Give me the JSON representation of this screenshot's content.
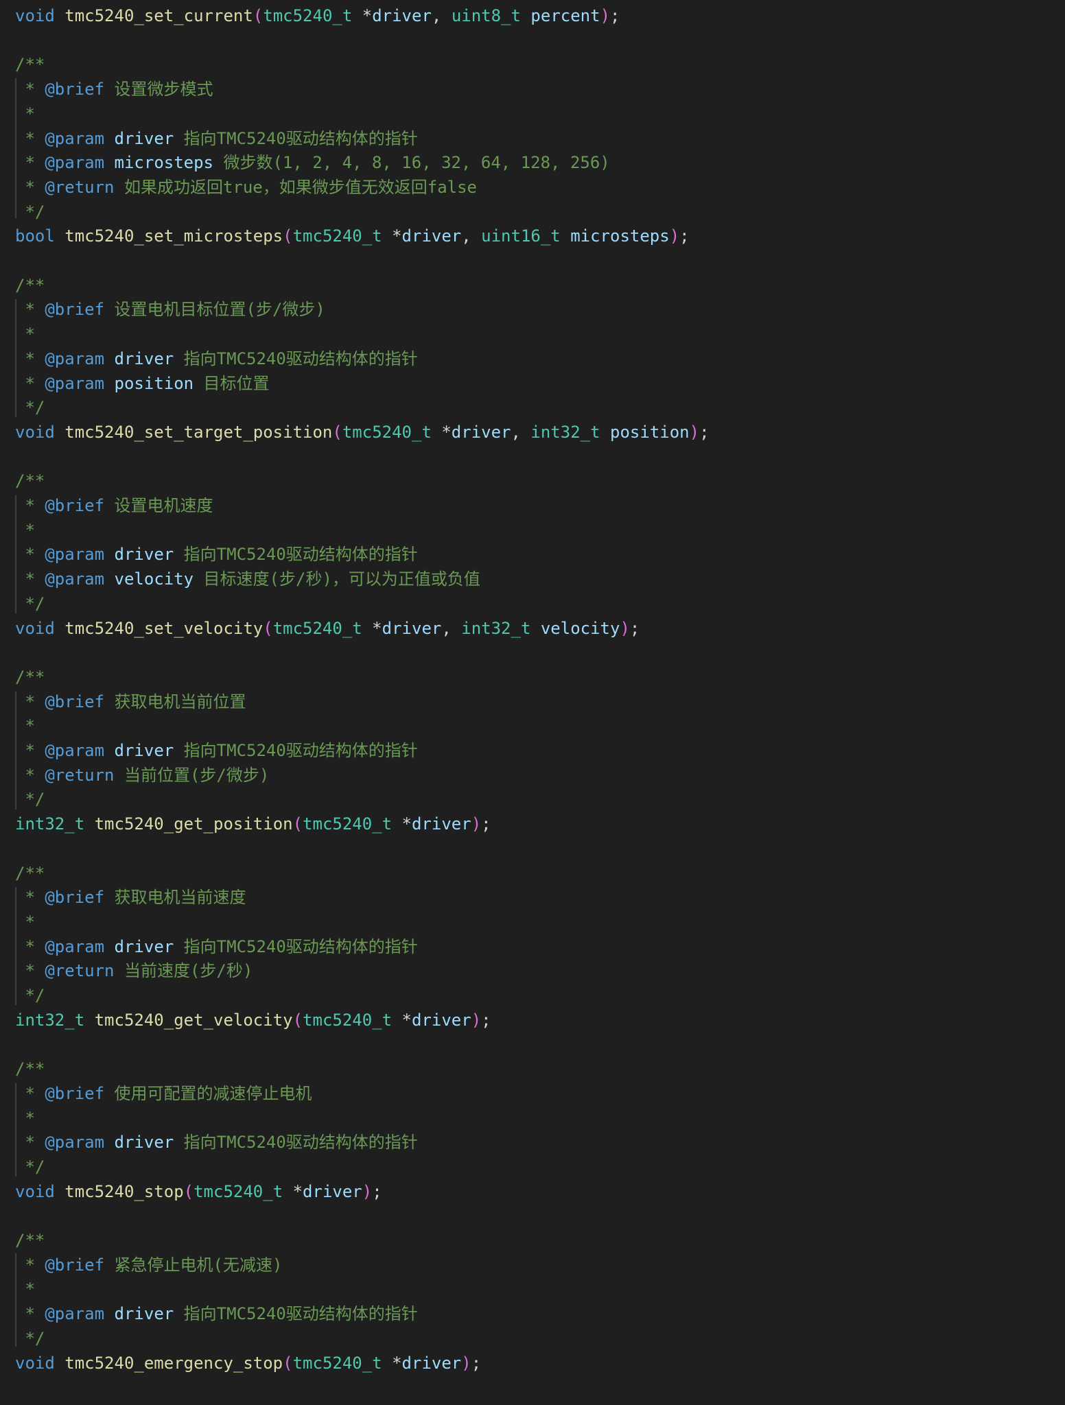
{
  "colors": {
    "background": "#1f1f1f",
    "comment": "#6a9955",
    "doc_tag": "#569cd6",
    "keyword": "#569cd6",
    "type": "#4ec9b0",
    "function": "#dcdcaa",
    "parameter": "#9cdcfe",
    "punctuation": "#d4d4d4",
    "bracket": "#da70d6",
    "indent_guide": "#404040"
  },
  "lines": [
    {
      "tokens": [
        [
          "kw",
          "void"
        ],
        [
          "pn",
          " "
        ],
        [
          "fn",
          "tmc5240_set_current"
        ],
        [
          "br",
          "("
        ],
        [
          "ty",
          "tmc5240_t"
        ],
        [
          "pn",
          " *"
        ],
        [
          "pm",
          "driver"
        ],
        [
          "pn",
          ", "
        ],
        [
          "ty",
          "uint8_t"
        ],
        [
          "pn",
          " "
        ],
        [
          "pm",
          "percent"
        ],
        [
          "br",
          ")"
        ],
        [
          "pn",
          ";"
        ]
      ]
    },
    {
      "tokens": []
    },
    {
      "tokens": [
        [
          "cm",
          "/**"
        ]
      ]
    },
    {
      "tokens": [
        [
          "cm",
          " * "
        ],
        [
          "tag",
          "@brief"
        ],
        [
          "cm",
          " 设置微步模式"
        ]
      ]
    },
    {
      "tokens": [
        [
          "cm",
          " *"
        ]
      ]
    },
    {
      "tokens": [
        [
          "cm",
          " * "
        ],
        [
          "tag",
          "@param"
        ],
        [
          "pn",
          " "
        ],
        [
          "pm",
          "driver"
        ],
        [
          "cm",
          " 指向TMC5240驱动结构体的指针"
        ]
      ]
    },
    {
      "tokens": [
        [
          "cm",
          " * "
        ],
        [
          "tag",
          "@param"
        ],
        [
          "pn",
          " "
        ],
        [
          "pm",
          "microsteps"
        ],
        [
          "cm",
          " 微步数(1, 2, 4, 8, 16, 32, 64, 128, 256)"
        ]
      ]
    },
    {
      "tokens": [
        [
          "cm",
          " * "
        ],
        [
          "tag",
          "@return"
        ],
        [
          "cm",
          " 如果成功返回true，如果微步值无效返回false"
        ]
      ]
    },
    {
      "tokens": [
        [
          "cm",
          " */"
        ]
      ]
    },
    {
      "tokens": [
        [
          "kw",
          "bool"
        ],
        [
          "pn",
          " "
        ],
        [
          "fn",
          "tmc5240_set_microsteps"
        ],
        [
          "br",
          "("
        ],
        [
          "ty",
          "tmc5240_t"
        ],
        [
          "pn",
          " *"
        ],
        [
          "pm",
          "driver"
        ],
        [
          "pn",
          ", "
        ],
        [
          "ty",
          "uint16_t"
        ],
        [
          "pn",
          " "
        ],
        [
          "pm",
          "microsteps"
        ],
        [
          "br",
          ")"
        ],
        [
          "pn",
          ";"
        ]
      ]
    },
    {
      "tokens": []
    },
    {
      "tokens": [
        [
          "cm",
          "/**"
        ]
      ]
    },
    {
      "tokens": [
        [
          "cm",
          " * "
        ],
        [
          "tag",
          "@brief"
        ],
        [
          "cm",
          " 设置电机目标位置(步/微步)"
        ]
      ]
    },
    {
      "tokens": [
        [
          "cm",
          " *"
        ]
      ]
    },
    {
      "tokens": [
        [
          "cm",
          " * "
        ],
        [
          "tag",
          "@param"
        ],
        [
          "pn",
          " "
        ],
        [
          "pm",
          "driver"
        ],
        [
          "cm",
          " 指向TMC5240驱动结构体的指针"
        ]
      ]
    },
    {
      "tokens": [
        [
          "cm",
          " * "
        ],
        [
          "tag",
          "@param"
        ],
        [
          "pn",
          " "
        ],
        [
          "pm",
          "position"
        ],
        [
          "cm",
          " 目标位置"
        ]
      ]
    },
    {
      "tokens": [
        [
          "cm",
          " */"
        ]
      ]
    },
    {
      "tokens": [
        [
          "kw",
          "void"
        ],
        [
          "pn",
          " "
        ],
        [
          "fn",
          "tmc5240_set_target_position"
        ],
        [
          "br",
          "("
        ],
        [
          "ty",
          "tmc5240_t"
        ],
        [
          "pn",
          " *"
        ],
        [
          "pm",
          "driver"
        ],
        [
          "pn",
          ", "
        ],
        [
          "ty",
          "int32_t"
        ],
        [
          "pn",
          " "
        ],
        [
          "pm",
          "position"
        ],
        [
          "br",
          ")"
        ],
        [
          "pn",
          ";"
        ]
      ]
    },
    {
      "tokens": []
    },
    {
      "tokens": [
        [
          "cm",
          "/**"
        ]
      ]
    },
    {
      "tokens": [
        [
          "cm",
          " * "
        ],
        [
          "tag",
          "@brief"
        ],
        [
          "cm",
          " 设置电机速度"
        ]
      ]
    },
    {
      "tokens": [
        [
          "cm",
          " *"
        ]
      ]
    },
    {
      "tokens": [
        [
          "cm",
          " * "
        ],
        [
          "tag",
          "@param"
        ],
        [
          "pn",
          " "
        ],
        [
          "pm",
          "driver"
        ],
        [
          "cm",
          " 指向TMC5240驱动结构体的指针"
        ]
      ]
    },
    {
      "tokens": [
        [
          "cm",
          " * "
        ],
        [
          "tag",
          "@param"
        ],
        [
          "pn",
          " "
        ],
        [
          "pm",
          "velocity"
        ],
        [
          "cm",
          " 目标速度(步/秒)，可以为正值或负值"
        ]
      ]
    },
    {
      "tokens": [
        [
          "cm",
          " */"
        ]
      ]
    },
    {
      "tokens": [
        [
          "kw",
          "void"
        ],
        [
          "pn",
          " "
        ],
        [
          "fn",
          "tmc5240_set_velocity"
        ],
        [
          "br",
          "("
        ],
        [
          "ty",
          "tmc5240_t"
        ],
        [
          "pn",
          " *"
        ],
        [
          "pm",
          "driver"
        ],
        [
          "pn",
          ", "
        ],
        [
          "ty",
          "int32_t"
        ],
        [
          "pn",
          " "
        ],
        [
          "pm",
          "velocity"
        ],
        [
          "br",
          ")"
        ],
        [
          "pn",
          ";"
        ]
      ]
    },
    {
      "tokens": []
    },
    {
      "tokens": [
        [
          "cm",
          "/**"
        ]
      ]
    },
    {
      "tokens": [
        [
          "cm",
          " * "
        ],
        [
          "tag",
          "@brief"
        ],
        [
          "cm",
          " 获取电机当前位置"
        ]
      ]
    },
    {
      "tokens": [
        [
          "cm",
          " *"
        ]
      ]
    },
    {
      "tokens": [
        [
          "cm",
          " * "
        ],
        [
          "tag",
          "@param"
        ],
        [
          "pn",
          " "
        ],
        [
          "pm",
          "driver"
        ],
        [
          "cm",
          " 指向TMC5240驱动结构体的指针"
        ]
      ]
    },
    {
      "tokens": [
        [
          "cm",
          " * "
        ],
        [
          "tag",
          "@return"
        ],
        [
          "cm",
          " 当前位置(步/微步)"
        ]
      ]
    },
    {
      "tokens": [
        [
          "cm",
          " */"
        ]
      ]
    },
    {
      "tokens": [
        [
          "ty",
          "int32_t"
        ],
        [
          "pn",
          " "
        ],
        [
          "fn",
          "tmc5240_get_position"
        ],
        [
          "br",
          "("
        ],
        [
          "ty",
          "tmc5240_t"
        ],
        [
          "pn",
          " *"
        ],
        [
          "pm",
          "driver"
        ],
        [
          "br",
          ")"
        ],
        [
          "pn",
          ";"
        ]
      ]
    },
    {
      "tokens": []
    },
    {
      "tokens": [
        [
          "cm",
          "/**"
        ]
      ]
    },
    {
      "tokens": [
        [
          "cm",
          " * "
        ],
        [
          "tag",
          "@brief"
        ],
        [
          "cm",
          " 获取电机当前速度"
        ]
      ]
    },
    {
      "tokens": [
        [
          "cm",
          " *"
        ]
      ]
    },
    {
      "tokens": [
        [
          "cm",
          " * "
        ],
        [
          "tag",
          "@param"
        ],
        [
          "pn",
          " "
        ],
        [
          "pm",
          "driver"
        ],
        [
          "cm",
          " 指向TMC5240驱动结构体的指针"
        ]
      ]
    },
    {
      "tokens": [
        [
          "cm",
          " * "
        ],
        [
          "tag",
          "@return"
        ],
        [
          "cm",
          " 当前速度(步/秒)"
        ]
      ]
    },
    {
      "tokens": [
        [
          "cm",
          " */"
        ]
      ]
    },
    {
      "tokens": [
        [
          "ty",
          "int32_t"
        ],
        [
          "pn",
          " "
        ],
        [
          "fn",
          "tmc5240_get_velocity"
        ],
        [
          "br",
          "("
        ],
        [
          "ty",
          "tmc5240_t"
        ],
        [
          "pn",
          " *"
        ],
        [
          "pm",
          "driver"
        ],
        [
          "br",
          ")"
        ],
        [
          "pn",
          ";"
        ]
      ]
    },
    {
      "tokens": []
    },
    {
      "tokens": [
        [
          "cm",
          "/**"
        ]
      ]
    },
    {
      "tokens": [
        [
          "cm",
          " * "
        ],
        [
          "tag",
          "@brief"
        ],
        [
          "cm",
          " 使用可配置的减速停止电机"
        ]
      ]
    },
    {
      "tokens": [
        [
          "cm",
          " *"
        ]
      ]
    },
    {
      "tokens": [
        [
          "cm",
          " * "
        ],
        [
          "tag",
          "@param"
        ],
        [
          "pn",
          " "
        ],
        [
          "pm",
          "driver"
        ],
        [
          "cm",
          " 指向TMC5240驱动结构体的指针"
        ]
      ]
    },
    {
      "tokens": [
        [
          "cm",
          " */"
        ]
      ]
    },
    {
      "tokens": [
        [
          "kw",
          "void"
        ],
        [
          "pn",
          " "
        ],
        [
          "fn",
          "tmc5240_stop"
        ],
        [
          "br",
          "("
        ],
        [
          "ty",
          "tmc5240_t"
        ],
        [
          "pn",
          " *"
        ],
        [
          "pm",
          "driver"
        ],
        [
          "br",
          ")"
        ],
        [
          "pn",
          ";"
        ]
      ]
    },
    {
      "tokens": []
    },
    {
      "tokens": [
        [
          "cm",
          "/**"
        ]
      ]
    },
    {
      "tokens": [
        [
          "cm",
          " * "
        ],
        [
          "tag",
          "@brief"
        ],
        [
          "cm",
          " 紧急停止电机(无减速)"
        ]
      ]
    },
    {
      "tokens": [
        [
          "cm",
          " *"
        ]
      ]
    },
    {
      "tokens": [
        [
          "cm",
          " * "
        ],
        [
          "tag",
          "@param"
        ],
        [
          "pn",
          " "
        ],
        [
          "pm",
          "driver"
        ],
        [
          "cm",
          " 指向TMC5240驱动结构体的指针"
        ]
      ]
    },
    {
      "tokens": [
        [
          "cm",
          " */"
        ]
      ]
    },
    {
      "tokens": [
        [
          "kw",
          "void"
        ],
        [
          "pn",
          " "
        ],
        [
          "fn",
          "tmc5240_emergency_stop"
        ],
        [
          "br",
          "("
        ],
        [
          "ty",
          "tmc5240_t"
        ],
        [
          "pn",
          " *"
        ],
        [
          "pm",
          "driver"
        ],
        [
          "br",
          ")"
        ],
        [
          "pn",
          ";"
        ]
      ]
    }
  ]
}
